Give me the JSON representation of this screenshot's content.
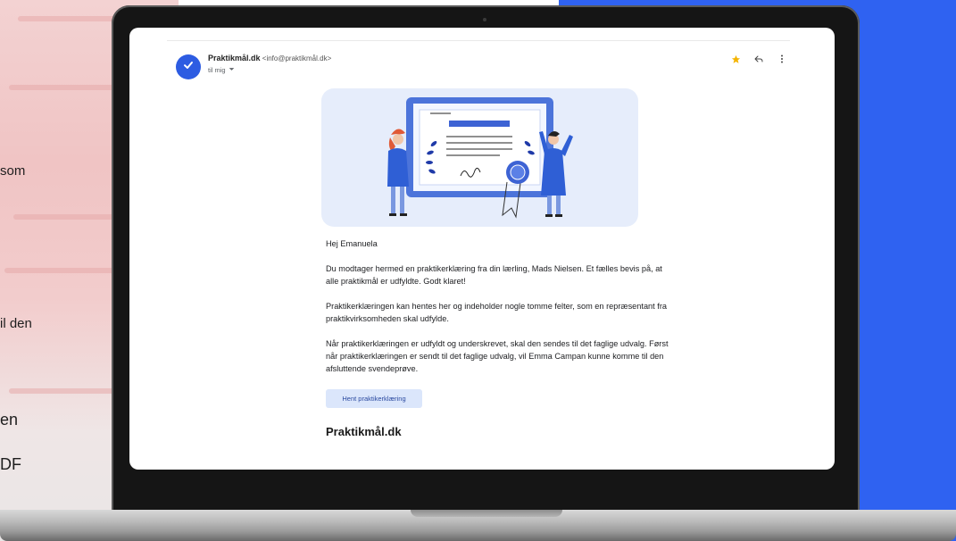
{
  "side_text": [
    "som",
    "il den",
    "en",
    "DF"
  ],
  "email": {
    "sender_name": "Praktikmål.dk",
    "sender_address": "<info@praktikmål.dk>",
    "recipient": "til mig",
    "greeting": "Hej Emanuela",
    "paragraph_1": "Du modtager hermed en praktikerklæring fra din lærling, Mads Nielsen. Et fælles bevis på, at alle praktikmål er udfyldte. Godt klaret!",
    "paragraph_2": "Praktikerklæringen kan hentes her og indeholder nogle tomme felter, som en repræsentant fra praktikvirksomheden skal udfylde.",
    "paragraph_3": "Når praktikerklæringen er udfyldt og underskrevet, skal den sendes til det faglige udvalg. Først når praktikerklæringen er sendt til det faglige udvalg, vil Emma Campan kunne komme til den afsluttende svendeprøve.",
    "button_label": "Hent praktikerklæring",
    "signature": "Praktikmål.dk"
  },
  "icons": [
    "check-icon",
    "chevron-down-icon",
    "star-icon",
    "reply-icon",
    "more-vertical-icon"
  ],
  "colors": {
    "accent": "#2d5ce2",
    "star": "#f4b400",
    "right_panel": "#2f62f1",
    "button_bg": "#dbe6fb"
  }
}
